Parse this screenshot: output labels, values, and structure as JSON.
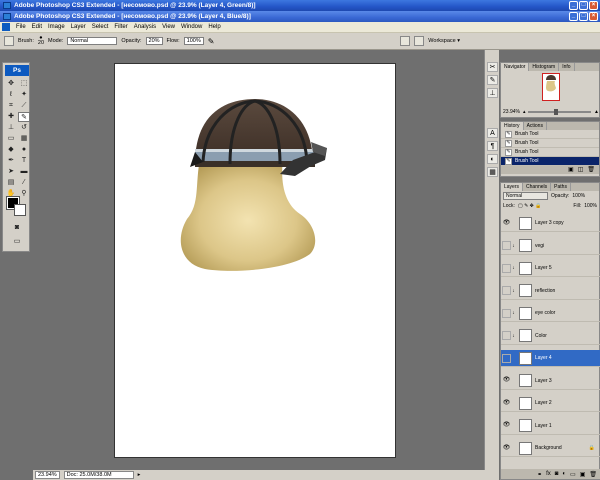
{
  "window1": {
    "title": "Adobe Photoshop CS3 Extended - [несомово.psd @ 23.9% (Layer 4, Green/8)]"
  },
  "window2": {
    "title": "Adobe Photoshop CS3 Extended - [несомово.psd @ 23.9% (Layer 4, Blue/8)]"
  },
  "menu": [
    "File",
    "Edit",
    "Image",
    "Layer",
    "Select",
    "Filter",
    "Analysis",
    "View",
    "Window",
    "Help"
  ],
  "options": {
    "brush_label": "Brush:",
    "brush_size": "20",
    "mode_label": "Mode:",
    "mode_value": "Normal",
    "opacity_label": "Opacity:",
    "opacity_value": "20%",
    "flow_label": "Flow:",
    "flow_value": "100%",
    "workspace": "Workspace ▾"
  },
  "toolbox": {
    "logo": "Ps"
  },
  "navigator": {
    "tabs": [
      "Navigator",
      "Histogram",
      "Info"
    ],
    "zoom": "23.94%"
  },
  "history": {
    "tabs": [
      "History",
      "Actions"
    ],
    "items": [
      "Brush Tool",
      "Brush Tool",
      "Brush Tool",
      "Brush Tool"
    ],
    "selected_index": 3
  },
  "layers_panel": {
    "tabs": [
      "Layers",
      "Channels",
      "Paths"
    ],
    "blend_mode": "Normal",
    "opacity_label": "Opacity:",
    "opacity": "100%",
    "lock_label": "Lock:",
    "fill_label": "Fill:",
    "fill": "100%",
    "items": [
      {
        "name": "Layer 3 copy",
        "visible": true
      },
      {
        "name": "vegi",
        "visible": false
      },
      {
        "name": "Layer 5",
        "visible": false
      },
      {
        "name": "reflection",
        "visible": false
      },
      {
        "name": "eye color",
        "visible": false
      },
      {
        "name": "Color",
        "visible": false
      },
      {
        "name": "Layer 4",
        "visible": false
      },
      {
        "name": "Layer 3",
        "visible": true
      },
      {
        "name": "Layer 2",
        "visible": true
      },
      {
        "name": "Layer 1",
        "visible": true
      },
      {
        "name": "Background",
        "visible": true
      }
    ],
    "selected_index": 6
  },
  "status": {
    "zoom": "23.94%",
    "doc": "Doc: 25.0M/38.0M"
  }
}
